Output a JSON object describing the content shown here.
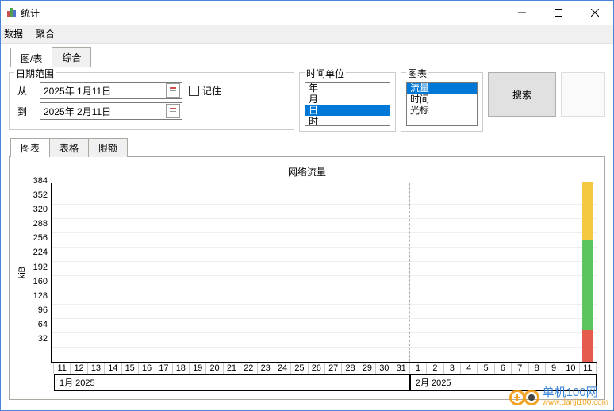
{
  "window": {
    "title": "统计"
  },
  "menu": {
    "data": "数据",
    "aggregate": "聚合"
  },
  "mainTabs": {
    "chartTable": "图/表",
    "comprehensive": "综合"
  },
  "dateRange": {
    "legend": "日期范围",
    "fromLabel": "从",
    "toLabel": "到",
    "fromValue": "2025年 1月11日",
    "toValue": "2025年 2月11日",
    "remember": "记住"
  },
  "timeUnit": {
    "legend": "时间单位",
    "items": [
      "年",
      "月",
      "日",
      "时"
    ],
    "selectedIndex": 2
  },
  "chartSelect": {
    "legend": "图表",
    "items": [
      "流量",
      "时间",
      "光标"
    ],
    "selectedIndex": 0
  },
  "searchBtn": "搜索",
  "subTabs": {
    "chart": "图表",
    "table": "表格",
    "quota": "限额"
  },
  "chart_data": {
    "type": "bar",
    "title": "网络流量",
    "ylabel": "kiB",
    "ylim": [
      0,
      400
    ],
    "yticks": [
      32,
      64,
      96,
      128,
      160,
      192,
      224,
      256,
      288,
      320,
      352,
      384
    ],
    "x_groups": [
      {
        "label": "1月 2025",
        "days": [
          11,
          12,
          13,
          14,
          15,
          16,
          17,
          18,
          19,
          20,
          21,
          22,
          23,
          24,
          25,
          26,
          27,
          28,
          29,
          30,
          31
        ]
      },
      {
        "label": "2月 2025",
        "days": [
          1,
          2,
          3,
          4,
          5,
          6,
          7,
          8,
          9,
          10,
          11
        ]
      }
    ],
    "categories": [
      "11",
      "12",
      "13",
      "14",
      "15",
      "16",
      "17",
      "18",
      "19",
      "20",
      "21",
      "22",
      "23",
      "24",
      "25",
      "26",
      "27",
      "28",
      "29",
      "30",
      "31",
      "1",
      "2",
      "3",
      "4",
      "5",
      "6",
      "7",
      "8",
      "9",
      "10",
      "11"
    ],
    "series": [
      {
        "name": "seg-red",
        "color": "#e55b4e",
        "values": [
          0,
          0,
          0,
          0,
          0,
          0,
          0,
          0,
          0,
          0,
          0,
          0,
          0,
          0,
          0,
          0,
          0,
          0,
          0,
          0,
          0,
          0,
          0,
          0,
          0,
          0,
          0,
          0,
          0,
          0,
          0,
          70
        ]
      },
      {
        "name": "seg-green",
        "color": "#5cc65c",
        "values": [
          0,
          0,
          0,
          0,
          0,
          0,
          0,
          0,
          0,
          0,
          0,
          0,
          0,
          0,
          0,
          0,
          0,
          0,
          0,
          0,
          0,
          0,
          0,
          0,
          0,
          0,
          0,
          0,
          0,
          0,
          0,
          200
        ]
      },
      {
        "name": "seg-yellow",
        "color": "#f5c842",
        "values": [
          0,
          0,
          0,
          0,
          0,
          0,
          0,
          0,
          0,
          0,
          0,
          0,
          0,
          0,
          0,
          0,
          0,
          0,
          0,
          0,
          0,
          0,
          0,
          0,
          0,
          0,
          0,
          0,
          0,
          0,
          0,
          130
        ]
      }
    ]
  },
  "watermark": {
    "name": "单机100网",
    "url": "www.danji100.com"
  }
}
